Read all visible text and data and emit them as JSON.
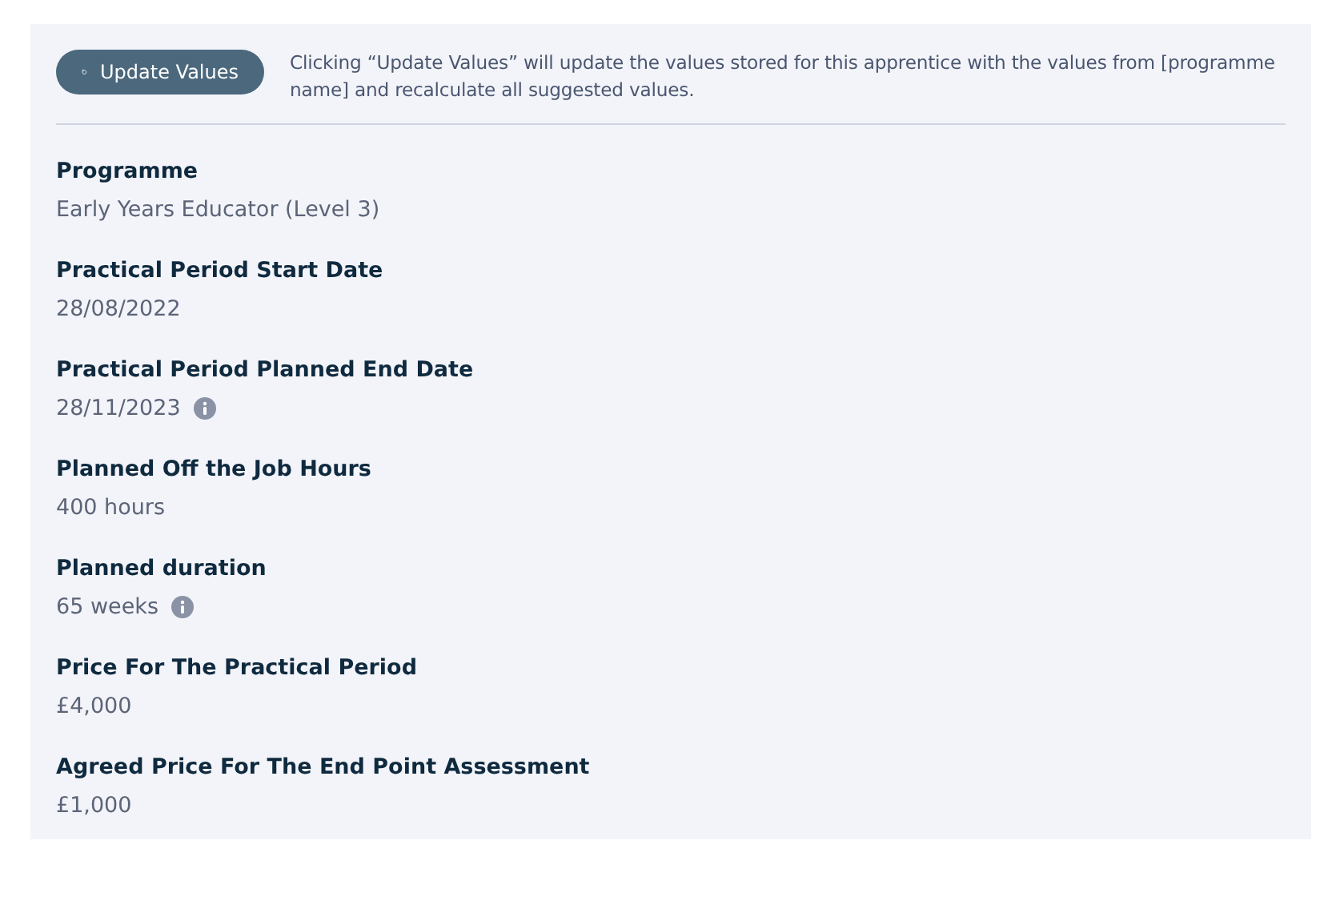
{
  "update_button": {
    "label": "Update Values"
  },
  "update_note": "Clicking “Update Values” will update the values stored for this apprentice with the values from [programme name] and recalculate all suggested values.",
  "fields": [
    {
      "label": "Programme",
      "value": "Early Years Educator (Level 3)",
      "has_info": false
    },
    {
      "label": "Practical Period Start Date",
      "value": "28/08/2022",
      "has_info": false
    },
    {
      "label": "Practical Period Planned End Date",
      "value": "28/11/2023",
      "has_info": true
    },
    {
      "label": "Planned Off the Job Hours",
      "value": "400 hours",
      "has_info": false
    },
    {
      "label": "Planned duration",
      "value": "65 weeks",
      "has_info": true
    },
    {
      "label": "Price For The Practical Period",
      "value": "£4,000",
      "has_info": false
    },
    {
      "label": "Agreed Price For The End Point Assessment",
      "value": "£1,000",
      "has_info": false
    }
  ]
}
